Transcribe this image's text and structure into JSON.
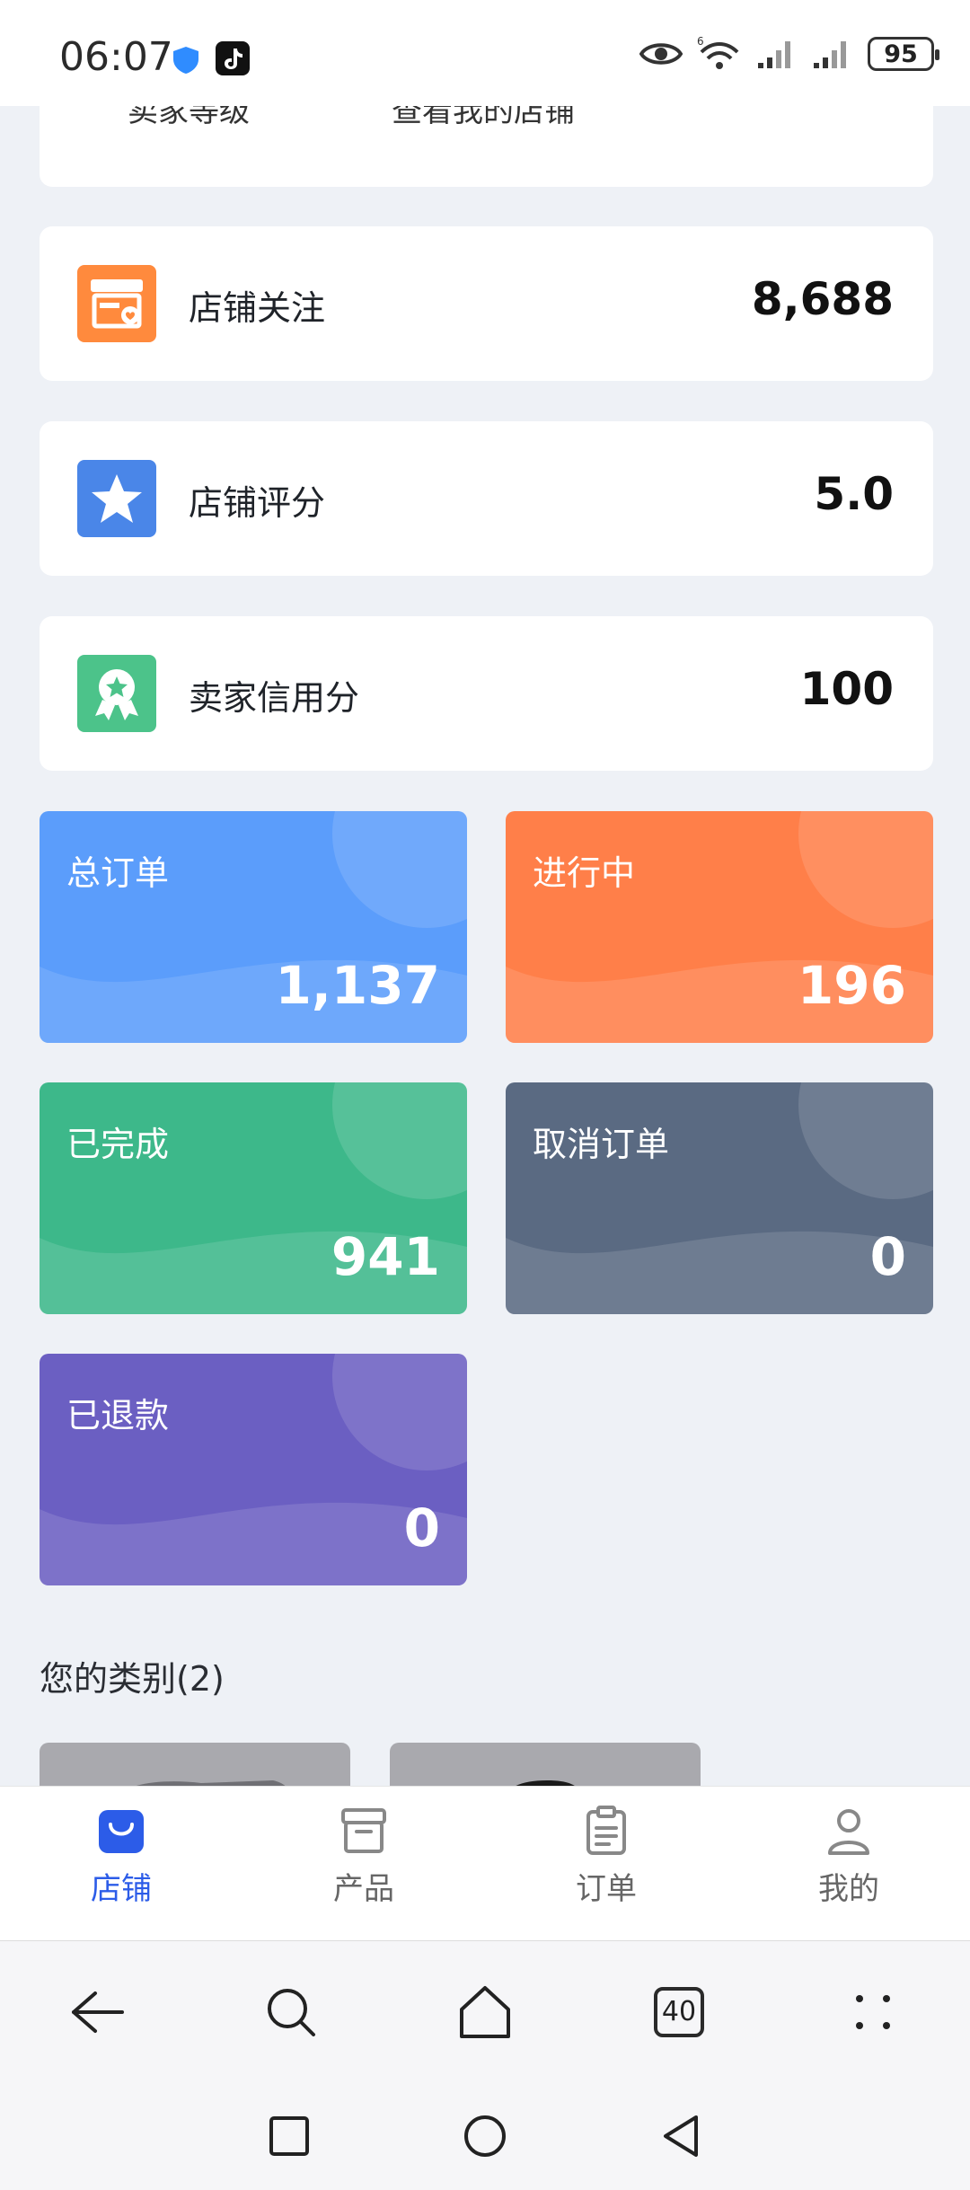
{
  "status_bar": {
    "time": "06:07",
    "battery": "95",
    "network_tag": "6"
  },
  "top_card": {
    "left_text": "卖家等级",
    "right_text": "查看我的店铺"
  },
  "info_cards": [
    {
      "label": "店铺关注",
      "value": "8,688",
      "icon": "store-heart-icon",
      "color": "#FF8A3D"
    },
    {
      "label": "店铺评分",
      "value": "5.0",
      "icon": "star-icon",
      "color": "#4A86E8"
    },
    {
      "label": "卖家信用分",
      "value": "100",
      "icon": "award-ribbon-icon",
      "color": "#4CC38A"
    }
  ],
  "stats": [
    {
      "label": "总订单",
      "value": "1,137",
      "color": "#5B9DFB"
    },
    {
      "label": "进行中",
      "value": "196",
      "color": "#FF7F49"
    },
    {
      "label": "已完成",
      "value": "941",
      "color": "#3DB88A"
    },
    {
      "label": "取消订单",
      "value": "0",
      "color": "#5A6A82"
    },
    {
      "label": "已退款",
      "value": "0",
      "color": "#6B5FC2"
    }
  ],
  "categories": {
    "title": "您的类别(2)"
  },
  "tabs": [
    {
      "label": "店铺",
      "icon": "shopping-bag-icon",
      "active": true
    },
    {
      "label": "产品",
      "icon": "archive-box-icon",
      "active": false
    },
    {
      "label": "订单",
      "icon": "clipboard-list-icon",
      "active": false
    },
    {
      "label": "我的",
      "icon": "user-icon",
      "active": false
    }
  ],
  "browser": {
    "tab_count": "40"
  },
  "accent_color": "#2C5CE8"
}
